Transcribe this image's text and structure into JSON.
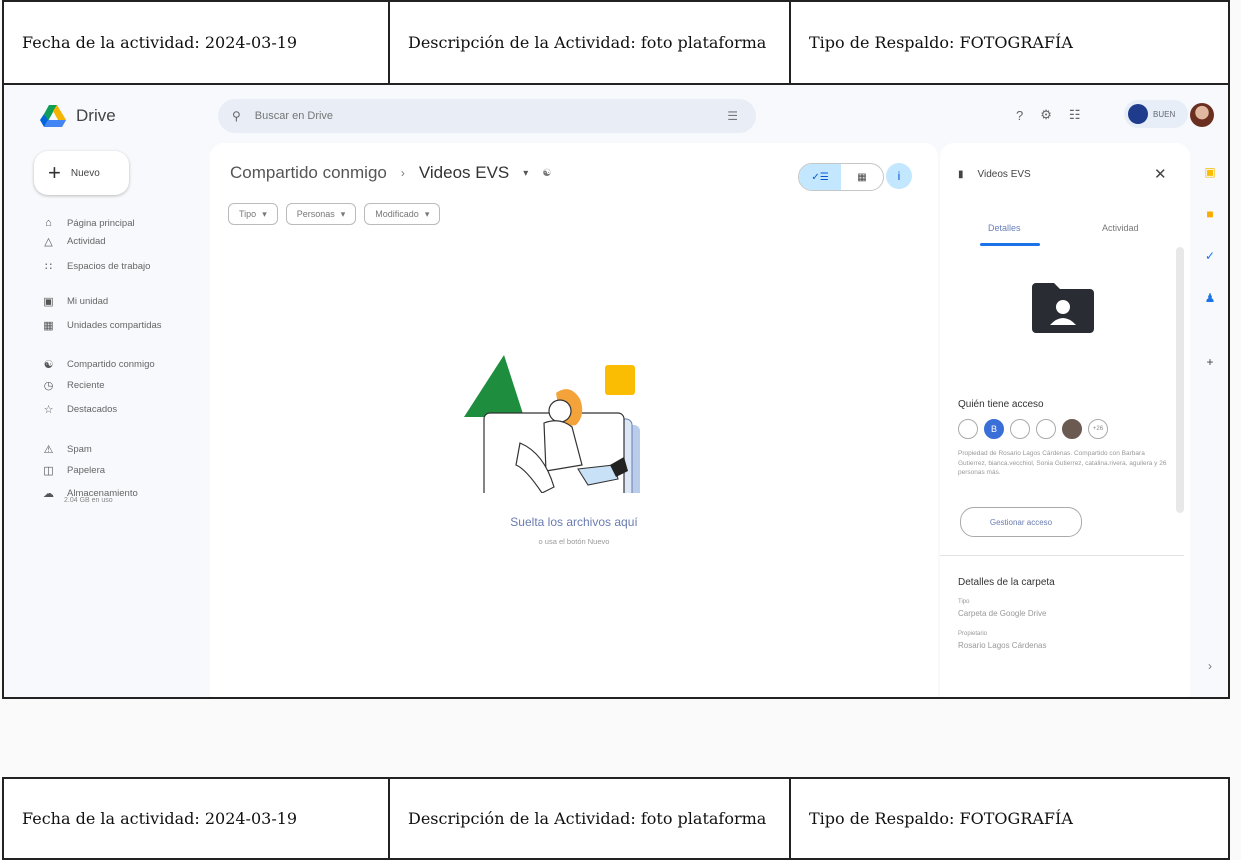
{
  "header_table": {
    "date": "Fecha de la actividad: 2024-03-19",
    "description": "Descripción de la Actividad: foto plataforma",
    "backup_type": "Tipo de Respaldo: FOTOGRAFÍA"
  },
  "drive": {
    "app_name": "Drive",
    "search_placeholder": "Buscar en Drive",
    "account_label": "BUEN",
    "new_button": "Nuevo",
    "nav": {
      "home": "Página principal",
      "activity": "Actividad",
      "workspaces": "Espacios de trabajo",
      "my_drive": "Mi unidad",
      "shared_drives": "Unidades compartidas",
      "shared_with_me": "Compartido conmigo",
      "recent": "Reciente",
      "starred": "Destacados",
      "spam": "Spam",
      "trash": "Papelera",
      "storage": "Almacenamiento"
    },
    "storage_used": "2.04 GB en uso",
    "breadcrumb": {
      "parent": "Compartido conmigo",
      "current": "Videos EVS"
    },
    "filters": [
      "Tipo",
      "Personas",
      "Modificado"
    ],
    "empty_title": "Suelta los archivos aquí",
    "empty_sub": "o usa el botón Nuevo",
    "panel": {
      "title": "Videos EVS",
      "tab_details": "Detalles",
      "tab_activity": "Actividad",
      "access_heading": "Quién tiene acceso",
      "avatar_letter": "B",
      "more_count": "+26",
      "access_text": "Propiedad de Rosario Lagos Cárdenas. Compartido con Barbara Gutierrez, bianca.vecchiol, Sonia Gutierrez, catalina.rivera, aguilera y 26 personas más.",
      "manage_button": "Gestionar acceso",
      "folder_details_heading": "Detalles de la carpeta",
      "type_label": "Tipo",
      "type_value": "Carpeta de Google Drive",
      "owner_label": "Propietario",
      "owner_value": "Rosario Lagos Cárdenas"
    },
    "colors": {
      "accent": "#1a73e8",
      "surface": "#f7f9fc"
    }
  }
}
